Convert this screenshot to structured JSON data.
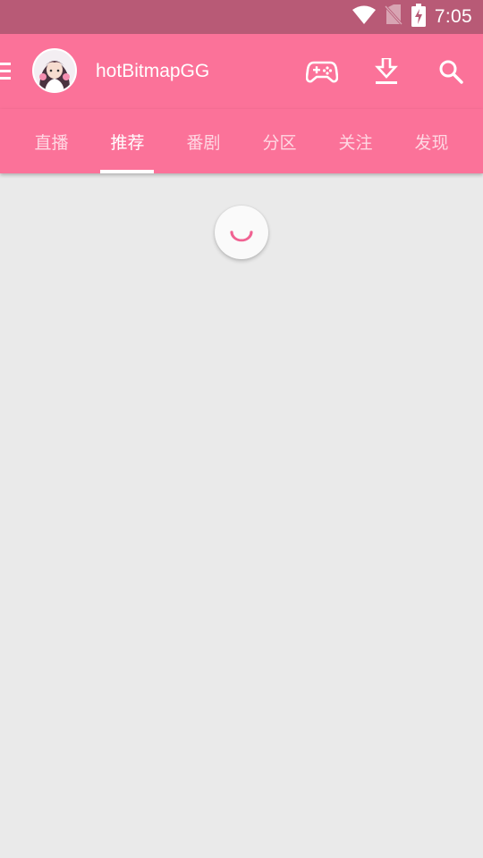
{
  "status_bar": {
    "time": "7:05",
    "icons": [
      "wifi-icon",
      "no-sim-icon",
      "battery-charging-icon"
    ]
  },
  "toolbar": {
    "title": "hotBitmapGG",
    "icons": [
      "menu-icon",
      "avatar",
      "gamepad-icon",
      "download-icon",
      "search-icon"
    ]
  },
  "tabs": {
    "items": [
      {
        "label": "直播"
      },
      {
        "label": "推荐"
      },
      {
        "label": "番剧"
      },
      {
        "label": "分区"
      },
      {
        "label": "关注"
      },
      {
        "label": "发现"
      }
    ],
    "selected": "推荐"
  },
  "content": {
    "state": "loading"
  },
  "colors": {
    "primary": "#fb7299",
    "status_bar": "#b85a76",
    "background": "#eaeaea",
    "accent": "#f06292"
  }
}
